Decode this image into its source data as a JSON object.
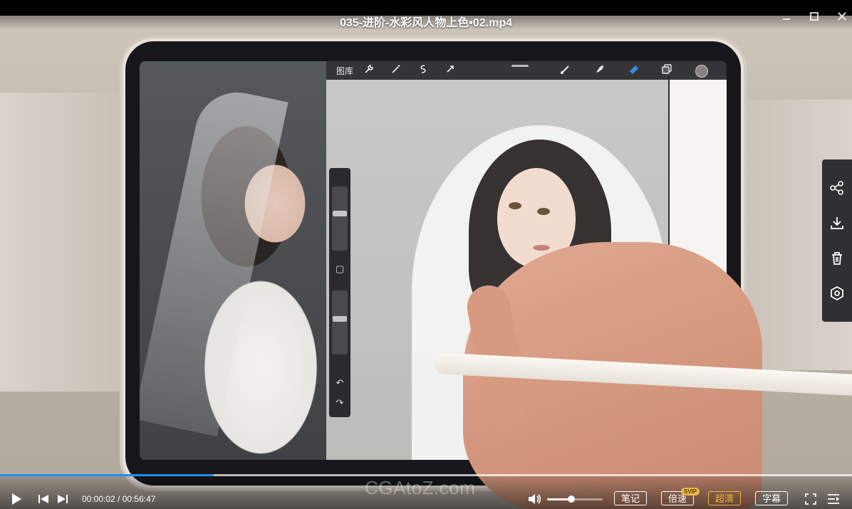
{
  "window": {
    "title": "035-进阶-水彩风人物上色•02.mp4",
    "controls": {
      "minimize": "minimize-icon",
      "maximize": "maximize-icon",
      "close": "close-icon"
    }
  },
  "app_screen": {
    "toolbar": {
      "gallery_label": "图库",
      "icons": [
        "wrench-icon",
        "magic-wand-icon",
        "selection-icon",
        "transform-icon",
        "brush-icon",
        "smudge-icon",
        "eraser-icon",
        "layers-icon",
        "color-swatch-icon"
      ]
    },
    "side_bar": {
      "undo": "undo-icon",
      "redo": "redo-icon",
      "modifier": "square-icon"
    }
  },
  "side_panel": {
    "buttons": [
      "share-icon",
      "download-icon",
      "delete-icon",
      "settings-icon"
    ]
  },
  "player": {
    "current_time": "00:00:02",
    "separator": " / ",
    "duration": "00:56:47",
    "progress_fraction": 0.251,
    "buffered_fraction": 1.0,
    "volume_fraction": 0.43,
    "watermark": "CGAtoZ.com",
    "buttons": {
      "notes": "笔记",
      "speed": "倍速",
      "speed_badge": "SVIP",
      "quality": "超清",
      "subtitles": "字幕"
    },
    "accent_color": "#1f8ff0",
    "quality_color": "#f0b43a"
  }
}
